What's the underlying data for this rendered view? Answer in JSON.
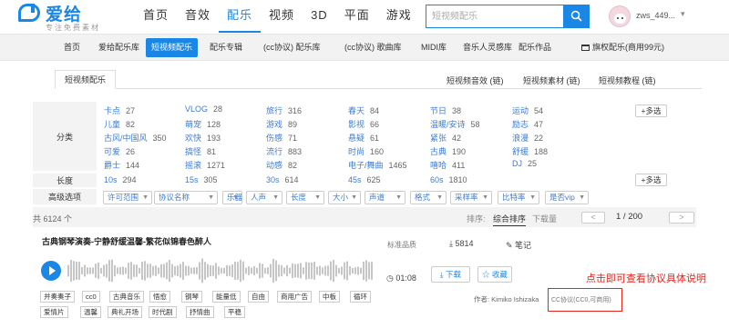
{
  "header": {
    "logo_name": "爱给",
    "slogan": "专注免费素材",
    "nav": [
      "首页",
      "音效",
      "配乐",
      "视频",
      "3D",
      "平面",
      "游戏",
      "教程"
    ],
    "active_nav": 2,
    "search_placeholder": "短视频配乐",
    "username": "zws_449...",
    "brand_color": "#1a87e5"
  },
  "subnav": {
    "items": [
      "首页",
      "爱给配乐库",
      "短视频配乐",
      "配乐专辑",
      "(cc协议) 配乐库",
      "(cc协议) 歌曲库",
      "MIDI库",
      "音乐人灵感库",
      "配乐作品"
    ],
    "active": 2,
    "vip_link": "旗权配乐(商用99元)"
  },
  "tabs": {
    "main": "短视频配乐",
    "links": [
      "短视频音效 (链)",
      "短视频素材 (链)",
      "短视频教程 (链)"
    ]
  },
  "filters": {
    "category_label": "分类",
    "categories": [
      [
        [
          "卡点",
          "27"
        ],
        [
          "VLOG",
          "28"
        ],
        [
          "旅行",
          "316"
        ],
        [
          "春天",
          "84"
        ],
        [
          "节日",
          "38"
        ],
        [
          "运动",
          "54"
        ]
      ],
      [
        [
          "儿童",
          "82"
        ],
        [
          "萌宠",
          "128"
        ],
        [
          "游戏",
          "89"
        ],
        [
          "影视",
          "66"
        ],
        [
          "温暖/安诗",
          "58"
        ],
        [
          "励志",
          "47"
        ]
      ],
      [
        [
          "古风/中国风",
          "350"
        ],
        [
          "欢快",
          "193"
        ],
        [
          "伤感",
          "71"
        ],
        [
          "悬疑",
          "61"
        ],
        [
          "紧张",
          "42"
        ],
        [
          "浪漫",
          "22"
        ]
      ],
      [
        [
          "可爱",
          "26"
        ],
        [
          "搞怪",
          "81"
        ],
        [
          "流行",
          "883"
        ],
        [
          "时尚",
          "160"
        ],
        [
          "古典",
          "190"
        ],
        [
          "舒缓",
          "188"
        ]
      ],
      [
        [
          "爵士",
          "144"
        ],
        [
          "摇滚",
          "1271"
        ],
        [
          "动感",
          "82"
        ],
        [
          "电子/舞曲",
          "1465"
        ],
        [
          "嘻哈",
          "411"
        ],
        [
          "DJ",
          "25"
        ]
      ]
    ],
    "more_label": "+多选",
    "length_label": "长度",
    "lengths": [
      [
        "10s",
        "294"
      ],
      [
        "15s",
        "305"
      ],
      [
        "30s",
        "614"
      ],
      [
        "45s",
        "625"
      ],
      [
        "60s",
        "1810"
      ]
    ],
    "advanced_label": "高级选项",
    "dropdowns": [
      "许可范围",
      "协议名称",
      "乐器",
      "人声",
      "长度",
      "大小",
      "声道",
      "格式",
      "采样率",
      "比特率",
      "是否vip"
    ]
  },
  "list": {
    "total": "共 6124 个",
    "sort_label": "排序:",
    "sort_active": "综合排序",
    "sort_download": "下载量",
    "page_prev": "<",
    "page_info": "1 / 200",
    "page_next": ">"
  },
  "track": {
    "title": "古典钢琴演奏-宁静舒缓温馨-繁花似锦春色醉人",
    "quality": "标准品质",
    "download_count": "5814",
    "note": "笔记",
    "duration": "01:08",
    "download_button": "下载",
    "favorite_button": "收藏",
    "author": "作者: Kimiko Ishizaka",
    "license": "CC协议(CC0,可商用)",
    "tags_row1": [
      "并奏奏子",
      "cc0",
      "古典音乐",
      "悟愈",
      "钢琴",
      "能量低",
      "自由",
      "商用广告",
      "中板",
      "循环"
    ],
    "tags_row2": [
      "爱情片",
      "温馨",
      "典礼开场",
      "时代剧",
      "抒情曲",
      "平稳"
    ]
  },
  "annotation": "点击即可查看协议具体说明",
  "icons": [
    "search-icon",
    "play-icon",
    "download-icon",
    "star-icon",
    "note-icon",
    "cart-icon"
  ]
}
